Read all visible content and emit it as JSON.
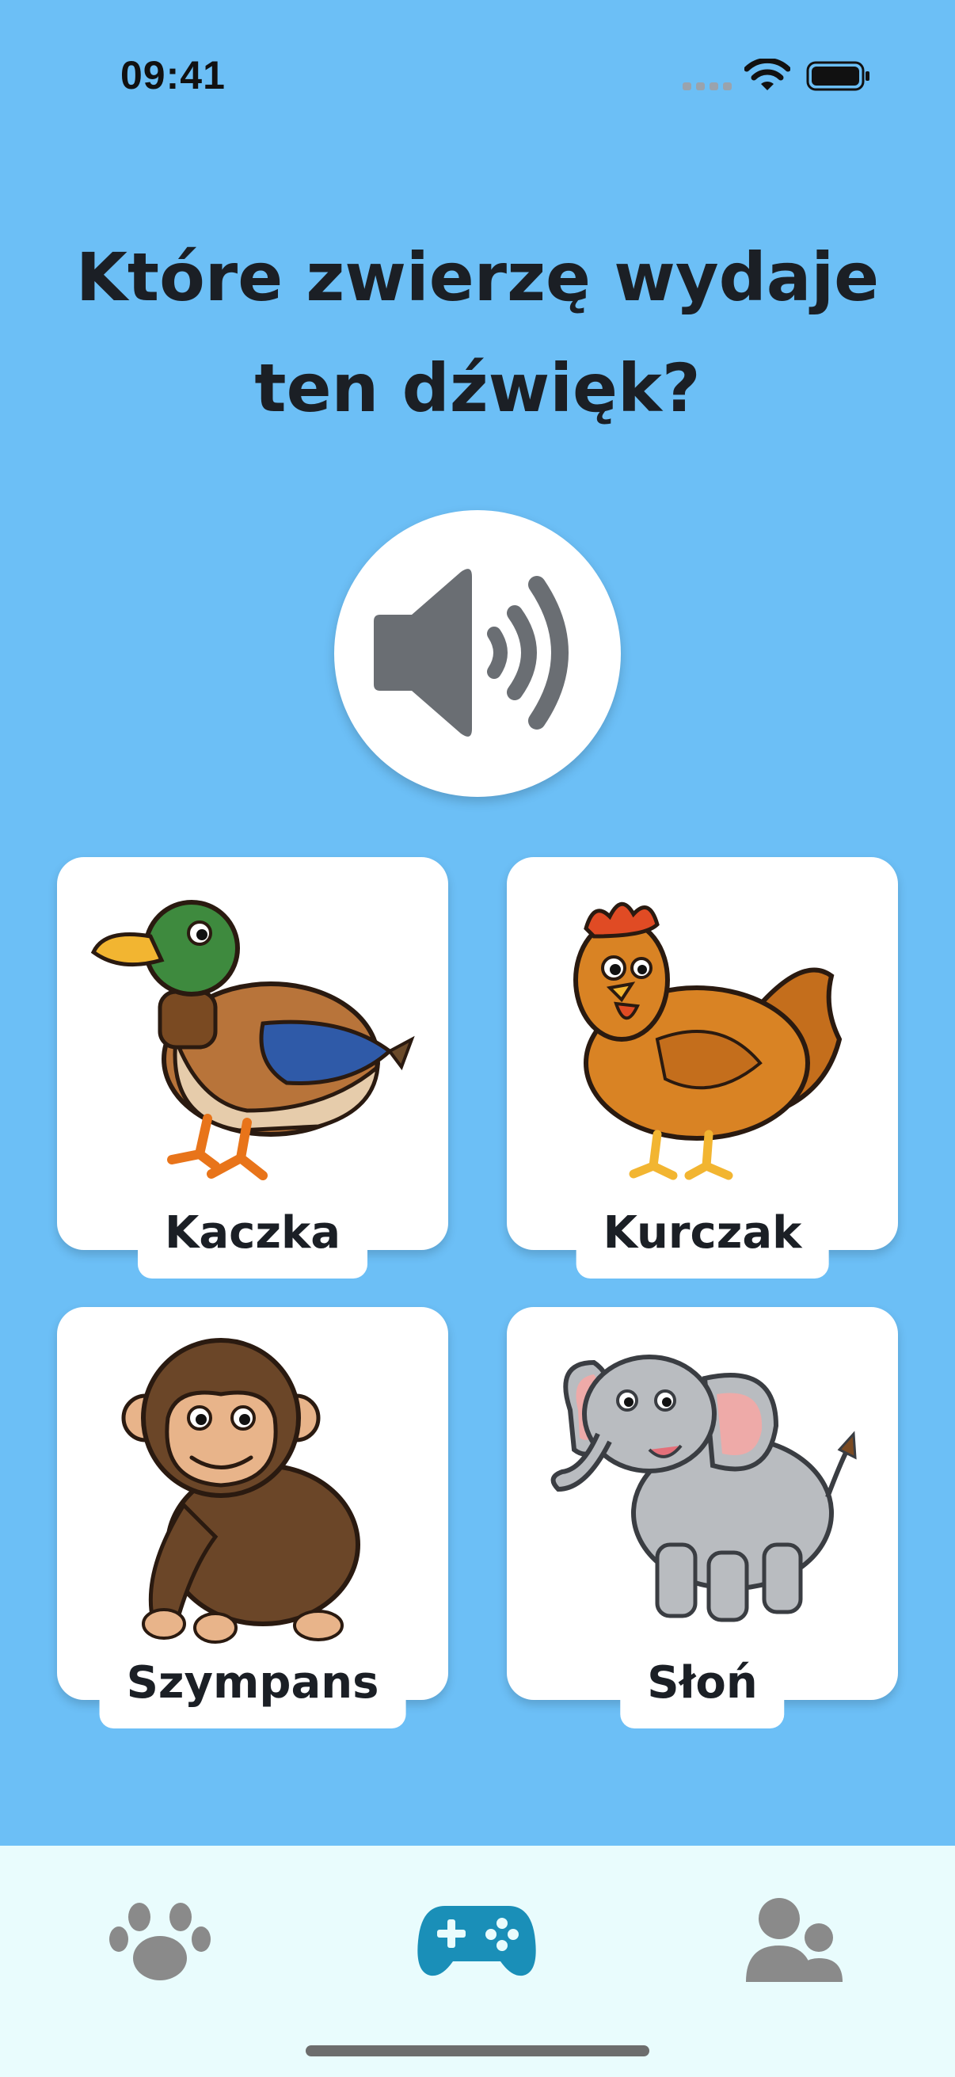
{
  "status_bar": {
    "time": "09:41"
  },
  "question": "Które zwierzę wydaje ten dźwięk?",
  "play_button": {
    "icon": "speaker-icon"
  },
  "options": [
    {
      "label": "Kaczka",
      "icon": "duck-image"
    },
    {
      "label": "Kurczak",
      "icon": "chicken-image"
    },
    {
      "label": "Szympans",
      "icon": "chimpanzee-image"
    },
    {
      "label": "Słoń",
      "icon": "elephant-image"
    }
  ],
  "tab_bar": {
    "tabs": [
      {
        "icon": "paw-icon",
        "active": false
      },
      {
        "icon": "gamepad-icon",
        "active": true
      },
      {
        "icon": "users-icon",
        "active": false
      }
    ]
  },
  "colors": {
    "background": "#6cbff6",
    "tab_bar_background": "#e9fcfd",
    "active_tab": "#1a8fb8",
    "inactive_tab": "#8a8a8a",
    "speaker": "#6a6e73"
  }
}
